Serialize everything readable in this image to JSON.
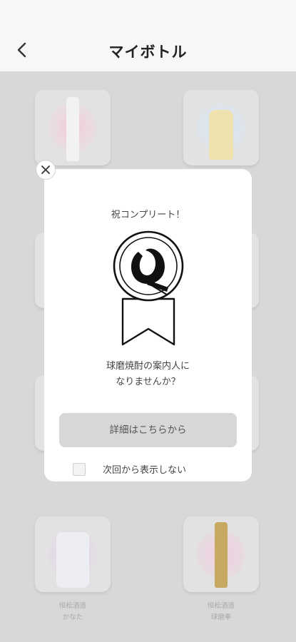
{
  "header": {
    "title": "マイボトル",
    "back_icon": "chevron-left-icon"
  },
  "bottles": [
    {
      "brand": "",
      "name": "",
      "glow": "#f0c6d4",
      "bottle": "#efefef"
    },
    {
      "brand": "",
      "name": "",
      "glow": "#cfe0f2",
      "bottle": "#f0e3b0"
    },
    {
      "brand": "恒松酒造",
      "name": "かなた",
      "glow": "#e8d6ec",
      "bottle": "#eceef5"
    },
    {
      "brand": "恒松酒造",
      "name": "球磨拳",
      "glow": "#f1cde0",
      "bottle": "#c7a95f"
    }
  ],
  "modal": {
    "heading": "祝コンプリート！",
    "message_line1": "球磨焼酎の案内人に",
    "message_line2": "なりませんか？",
    "detail_button": "詳細はこちらから",
    "checkbox_label": "次回から表示しない",
    "close_icon": "close-icon",
    "badge_icon": "award-ribbon-icon"
  },
  "colors": {
    "overlay": "#d8d8d8",
    "button_bg": "#d7d7d7"
  }
}
